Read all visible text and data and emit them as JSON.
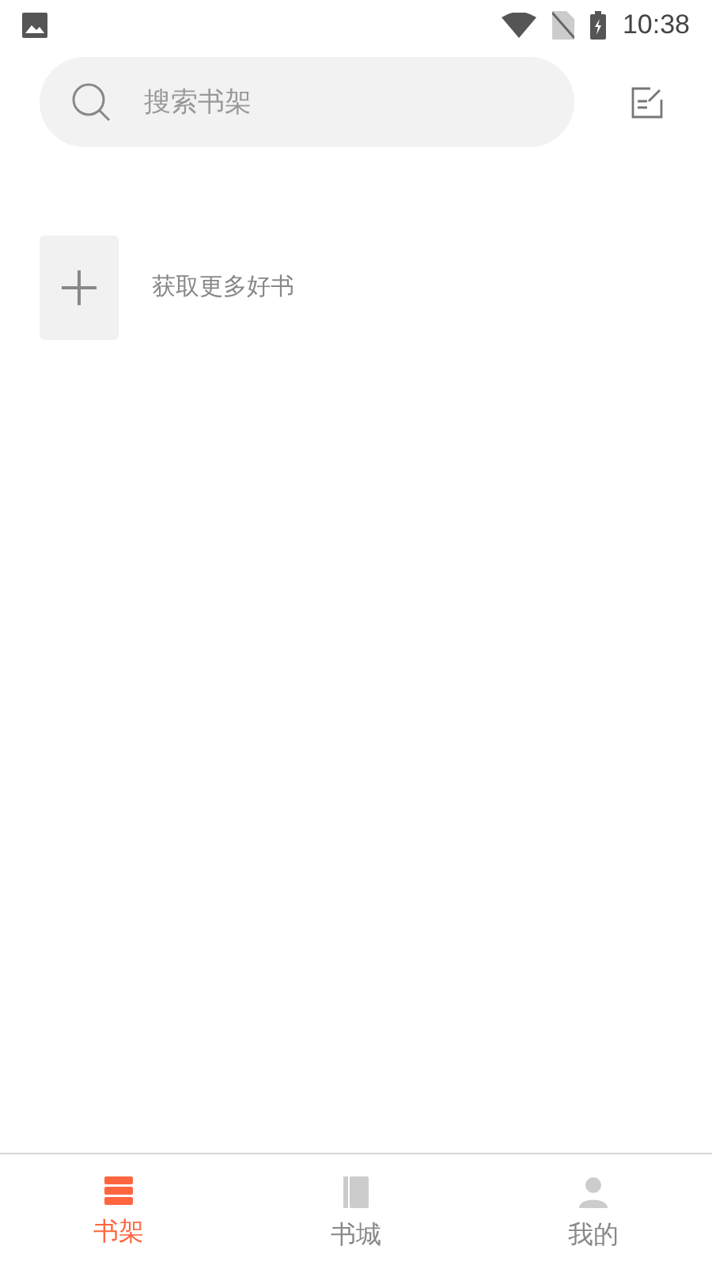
{
  "status_bar": {
    "time": "10:38"
  },
  "search": {
    "placeholder": "搜索书架"
  },
  "add_book": {
    "label": "获取更多好书"
  },
  "tabs": [
    {
      "label": "书架",
      "kind": "shelf",
      "selected": true
    },
    {
      "label": "书城",
      "kind": "book",
      "selected": false
    },
    {
      "label": "我的",
      "kind": "person",
      "selected": false
    }
  ]
}
